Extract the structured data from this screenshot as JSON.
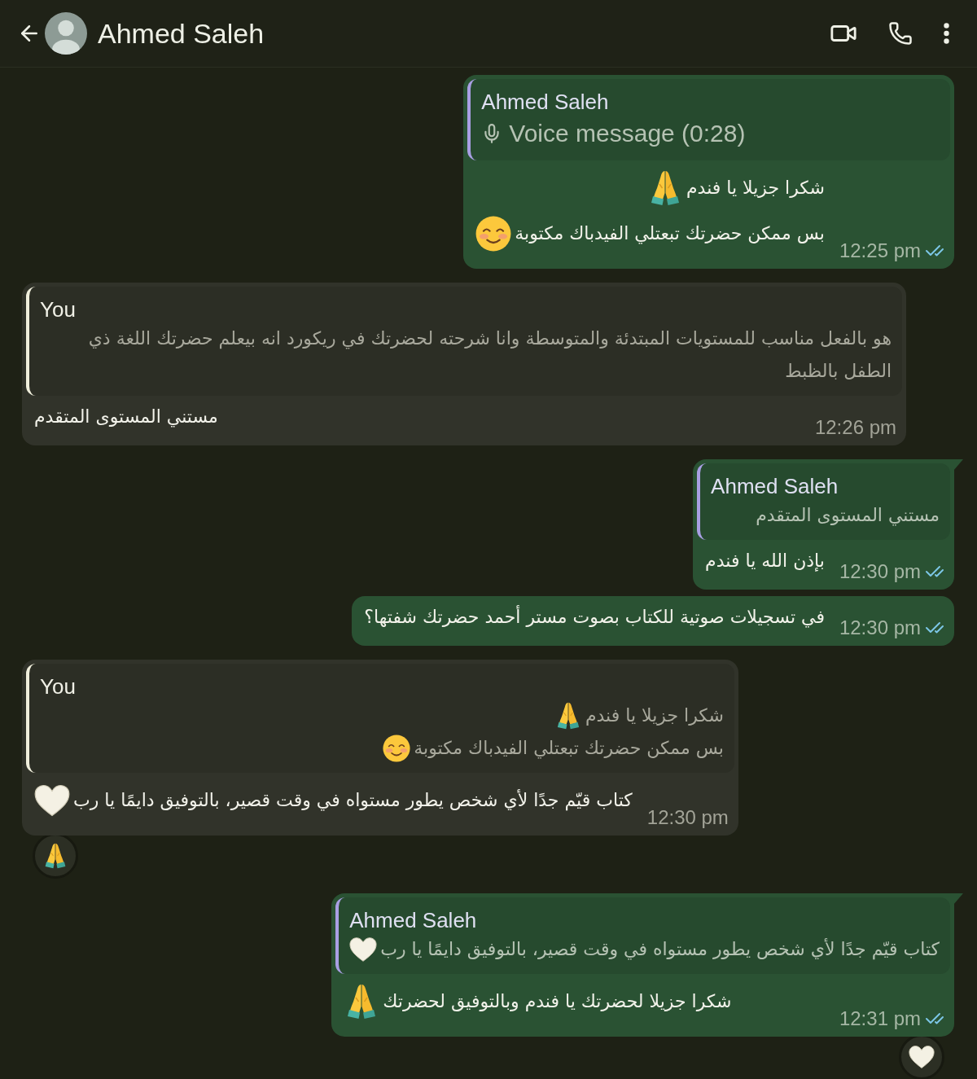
{
  "header": {
    "title": "Ahmed Saleh"
  },
  "messages": [
    {
      "kind": "outgoing",
      "tail": false,
      "quote": {
        "author": "Ahmed Saleh",
        "kind": "voice",
        "lines": [
          {
            "text": "Voice message (0:28)"
          }
        ]
      },
      "lines": [
        {
          "text": "شكرا جزيلا يا فندم",
          "emoji": {
            "kind": "folded_hands"
          }
        },
        {
          "text": "بس ممكن حضرتك تبعتلي الفيدباك مكتوبة",
          "emoji": {
            "kind": "smiling_face"
          }
        }
      ],
      "time": "12:25 pm",
      "read": true
    },
    {
      "kind": "incoming",
      "tail": false,
      "quote": {
        "author": "You",
        "kind": "text",
        "lines": [
          {
            "text": "هو بالفعل مناسب للمستويات المبتدئة والمتوسطة وانا شرحته لحضرتك في ريكورد انه بيعلم حضرتك اللغة ذي الطفل بالظبط"
          }
        ]
      },
      "lines": [
        {
          "text": "مستني المستوى المتقدم"
        }
      ],
      "time": "12:26 pm"
    },
    {
      "kind": "outgoing",
      "tail": true,
      "quote": {
        "author": "Ahmed Saleh",
        "kind": "text",
        "lines": [
          {
            "text": "مستني المستوى المتقدم"
          }
        ]
      },
      "lines": [
        {
          "text": "بإذن الله يا فندم"
        }
      ],
      "time": "12:30 pm",
      "read": true
    },
    {
      "kind": "outgoing",
      "tail": false,
      "lines": [
        {
          "text": "في تسجيلات صوتية للكتاب بصوت مستر أحمد حضرتك شفتها؟"
        }
      ],
      "time": "12:30 pm",
      "read": true
    },
    {
      "kind": "incoming",
      "tail": false,
      "quote": {
        "author": "You",
        "kind": "text",
        "lines": [
          {
            "text": "شكرا جزيلا يا فندم",
            "emoji": {
              "kind": "folded_hands"
            }
          },
          {
            "text": "بس ممكن حضرتك تبعتلي الفيدباك مكتوبة",
            "emoji": {
              "kind": "smiling_face"
            }
          }
        ]
      },
      "lines": [
        {
          "text": "كتاب قيّم جدًا لأي شخص يطور مستواه في وقت قصير، بالتوفيق دايمًا يا رب",
          "emoji": {
            "kind": "white_heart"
          }
        }
      ],
      "time": "12:30 pm",
      "reaction": {
        "kind": "folded_hands"
      }
    },
    {
      "kind": "outgoing",
      "tail": true,
      "quote": {
        "author": "Ahmed Saleh",
        "kind": "text",
        "lines": [
          {
            "text": "كتاب قيّم جدًا لأي شخص يطور مستواه في وقت قصير، بالتوفيق دايمًا يا رب",
            "emoji": {
              "kind": "white_heart"
            }
          }
        ]
      },
      "lines": [
        {
          "text": "شكرا جزيلا لحضرتك يا فندم وبالتوفيق لحضرتك",
          "emoji": {
            "kind": "folded_hands"
          }
        }
      ],
      "time": "12:31 pm",
      "read": true,
      "reaction": {
        "kind": "white_heart"
      }
    }
  ]
}
